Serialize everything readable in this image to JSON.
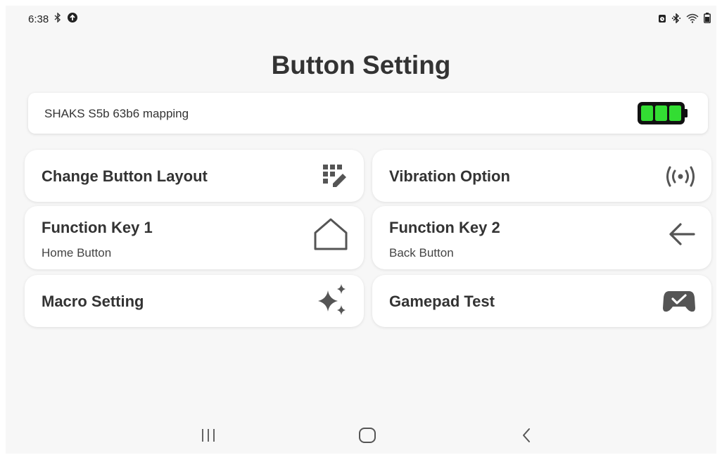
{
  "status_bar": {
    "time": "6:38",
    "left_icons": [
      "bluetooth-icon",
      "data-saver-icon"
    ],
    "right_icons": [
      "alarm-icon",
      "bluetooth-icon",
      "wifi-icon",
      "battery-icon"
    ]
  },
  "header": {
    "title": "Button Setting"
  },
  "device": {
    "name": "SHAKS S5b 63b6 mapping",
    "battery_level": 1.0,
    "battery_color": "#33dd33"
  },
  "cards": {
    "change_layout": {
      "title": "Change Button Layout",
      "icon": "layout-edit-icon"
    },
    "vibration": {
      "title": "Vibration Option",
      "icon": "vibration-icon"
    },
    "function_key_1": {
      "title": "Function Key 1",
      "subtitle": "Home Button",
      "icon": "home-icon"
    },
    "function_key_2": {
      "title": "Function Key 2",
      "subtitle": "Back Button",
      "icon": "back-arrow-icon"
    },
    "macro": {
      "title": "Macro Setting",
      "icon": "sparkle-icon"
    },
    "gamepad_test": {
      "title": "Gamepad Test",
      "icon": "gamepad-check-icon"
    }
  },
  "nav_bar": {
    "items": [
      "recents-button",
      "home-button",
      "back-button"
    ]
  },
  "colors": {
    "background": "#f7f7f7",
    "card": "#ffffff",
    "text": "#333333",
    "icon": "#555555",
    "battery": "#33dd33"
  }
}
